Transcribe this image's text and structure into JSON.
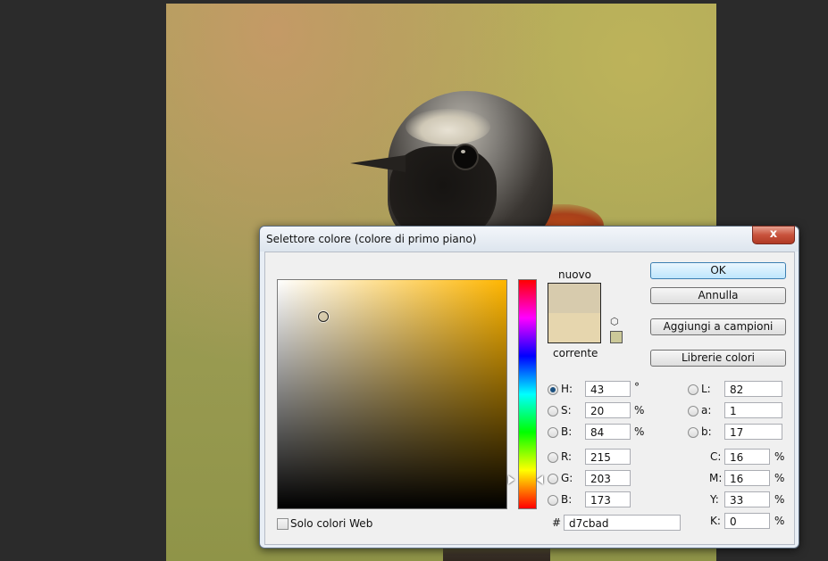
{
  "dialog": {
    "title": "Selettore colore (colore di primo piano)",
    "close_glyph": "x"
  },
  "swatch": {
    "new_label": "nuovo",
    "current_label": "corrente",
    "new_color": "#d7cbad",
    "current_color": "#e6d6ae"
  },
  "buttons": {
    "ok": "OK",
    "cancel": "Annulla",
    "add_to_swatches": "Aggiungi a campioni",
    "color_libraries": "Librerie colori"
  },
  "hsb": [
    {
      "label": "H:",
      "value": "43",
      "unit": "°",
      "selected": true
    },
    {
      "label": "S:",
      "value": "20",
      "unit": "%",
      "selected": false
    },
    {
      "label": "B:",
      "value": "84",
      "unit": "%",
      "selected": false
    }
  ],
  "rgb": [
    {
      "label": "R:",
      "value": "215"
    },
    {
      "label": "G:",
      "value": "203"
    },
    {
      "label": "B:",
      "value": "173"
    }
  ],
  "lab": [
    {
      "label": "L:",
      "value": "82"
    },
    {
      "label": "a:",
      "value": "1"
    },
    {
      "label": "b:",
      "value": "17"
    }
  ],
  "cmyk": [
    {
      "label": "C:",
      "value": "16",
      "unit": "%"
    },
    {
      "label": "M:",
      "value": "16",
      "unit": "%"
    },
    {
      "label": "Y:",
      "value": "33",
      "unit": "%"
    },
    {
      "label": "K:",
      "value": "0",
      "unit": "%"
    }
  ],
  "hex": {
    "label": "#",
    "value": "d7cbad"
  },
  "web_only": {
    "label": "Solo colori Web",
    "checked": false
  },
  "icons": [
    "close-icon",
    "cube-icon",
    "radio-icon",
    "checkbox-icon"
  ]
}
